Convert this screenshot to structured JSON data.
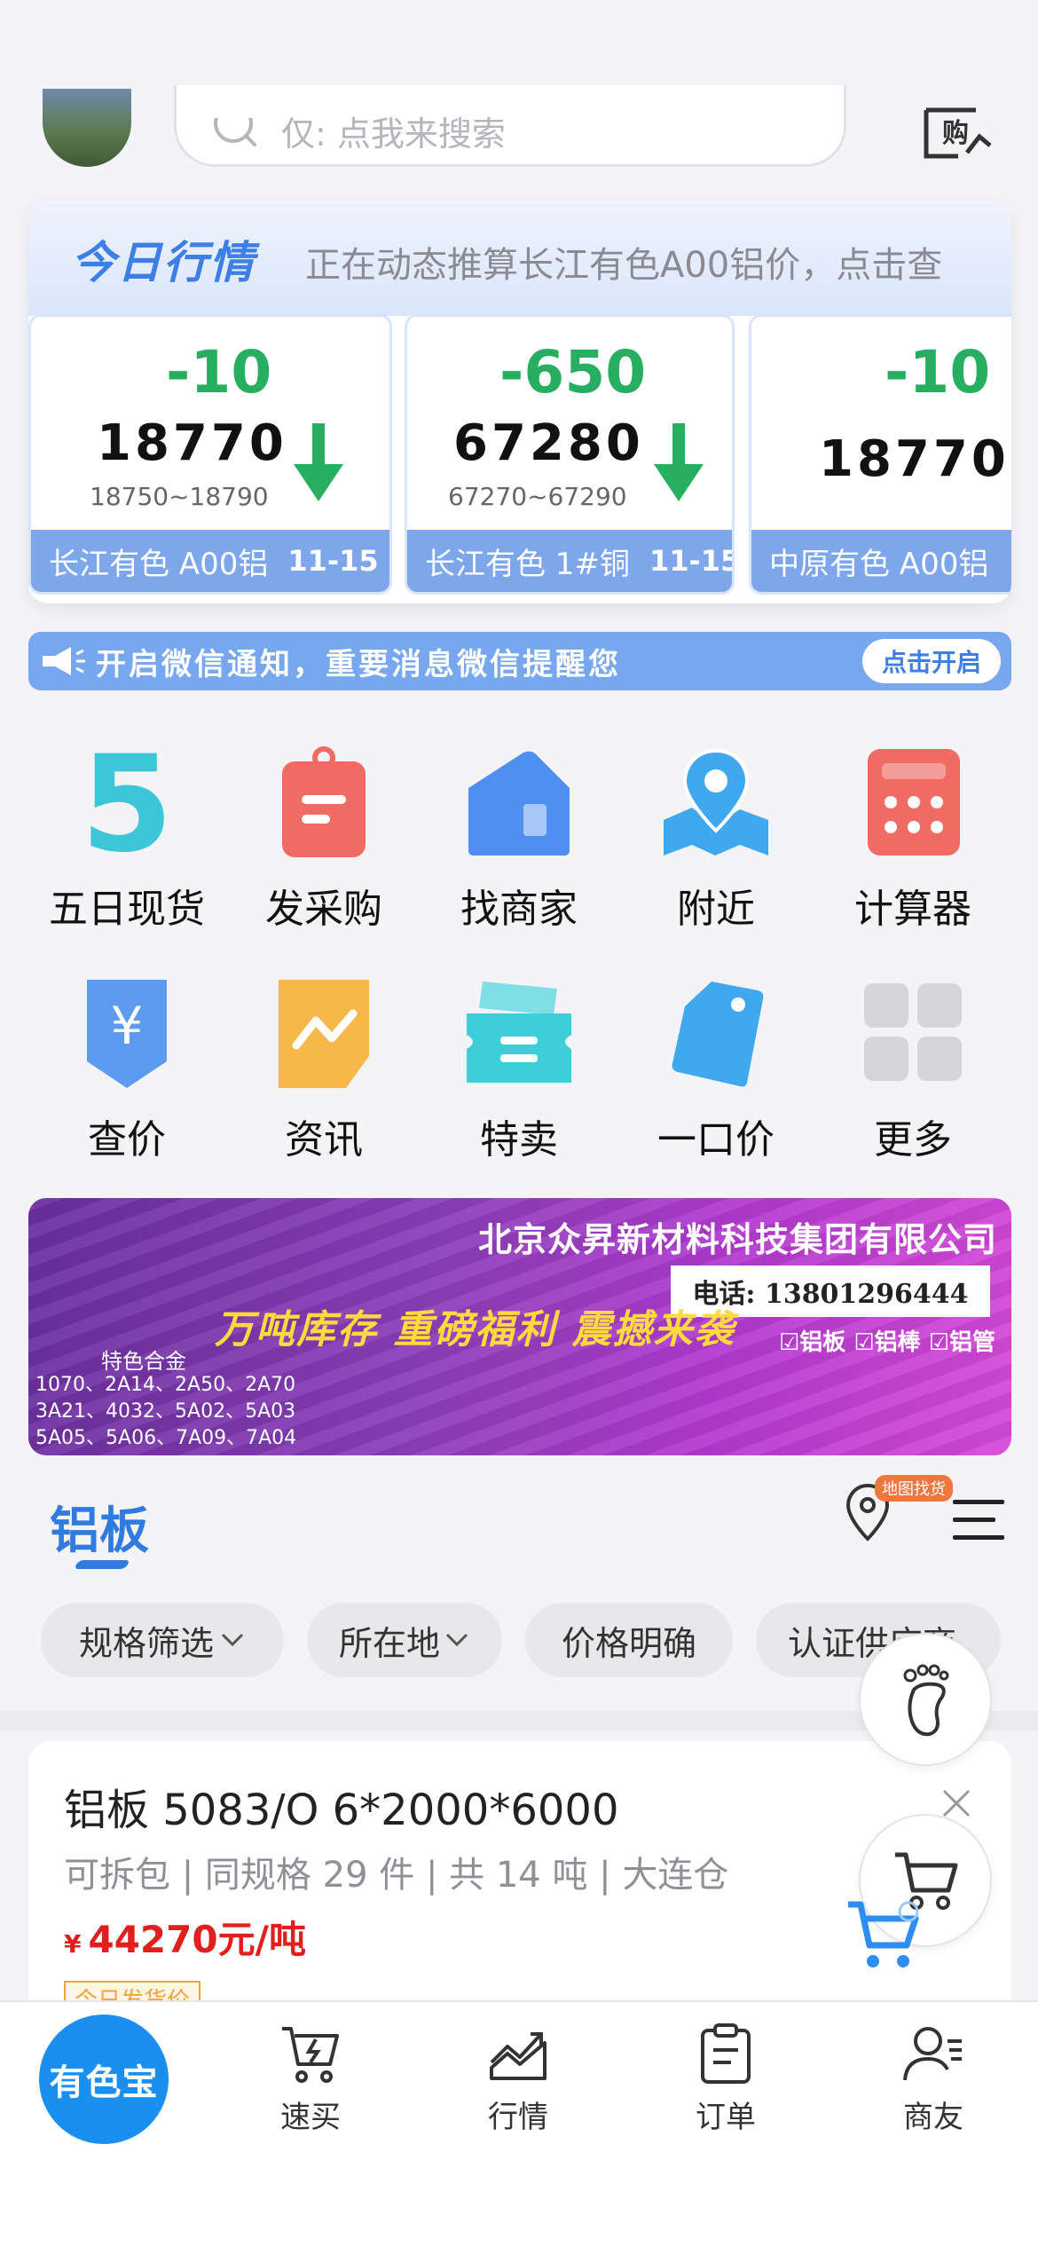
{
  "search": {
    "placeholder": "仅: 点我来搜索"
  },
  "market": {
    "title": "今日行情",
    "subtitle": "正在动态推算长江有色A00铝价，点击查",
    "quotes": [
      {
        "change": "-10",
        "price": "18770",
        "range": "18750~18790",
        "name": "长江有色 A00铝",
        "date": "11-15"
      },
      {
        "change": "-650",
        "price": "67280",
        "range": "67270~67290",
        "name": "长江有色 1#铜",
        "date": "11-15"
      },
      {
        "change": "-10",
        "price": "18770",
        "range": "",
        "name": "中原有色 A00铝",
        "date": ""
      }
    ]
  },
  "notice": {
    "text": "开启微信通知，重要消息微信提醒您",
    "button": "点击开启"
  },
  "grid": [
    {
      "label": "五日现货",
      "icon": "five-icon",
      "color": "#3cc6d8"
    },
    {
      "label": "发采购",
      "icon": "clipboard-icon",
      "color": "#f06b63"
    },
    {
      "label": "找商家",
      "icon": "shop-icon",
      "color": "#4e8ff0"
    },
    {
      "label": "附近",
      "icon": "map-pin-icon",
      "color": "#3fa8ef"
    },
    {
      "label": "计算器",
      "icon": "calculator-icon",
      "color": "#f06b63"
    },
    {
      "label": "查价",
      "icon": "yen-shield-icon",
      "color": "#5b9cf0"
    },
    {
      "label": "资讯",
      "icon": "news-chart-icon",
      "color": "#f7b84a"
    },
    {
      "label": "特卖",
      "icon": "ticket-icon",
      "color": "#3ccfd8"
    },
    {
      "label": "一口价",
      "icon": "price-tag-icon",
      "color": "#3fa8ef"
    },
    {
      "label": "更多",
      "icon": "grid-more-icon",
      "color": "#d6d6da"
    }
  ],
  "banner": {
    "company": "北京众昇新材料科技集团有限公司",
    "phone": "电话: 13801296444",
    "checks": "☑铝板  ☑铝棒  ☑铝管",
    "slogan": "万吨库存  重磅福利  震撼来袭",
    "alloy_title": "特色合金",
    "alloy_lines": [
      "1070、2A14、2A50、2A70",
      "3A21、4032、5A02、5A03",
      "5A05、5A06、7A09、7A04"
    ]
  },
  "section": {
    "title": "铝板",
    "map_badge": "地图找货"
  },
  "filters": [
    "规格筛选",
    "所在地",
    "价格明确",
    "认证供应商"
  ],
  "product": {
    "title": "铝板 5083/O 6*2000*6000",
    "meta": "可拆包 | 同规格 29 件 | 共 14 吨 | 大连仓",
    "currency": "¥",
    "price": "44270元/吨",
    "tag": "今日发货价"
  },
  "nav": {
    "home": "有色宝",
    "items": [
      "速买",
      "行情",
      "订单",
      "商友"
    ]
  }
}
